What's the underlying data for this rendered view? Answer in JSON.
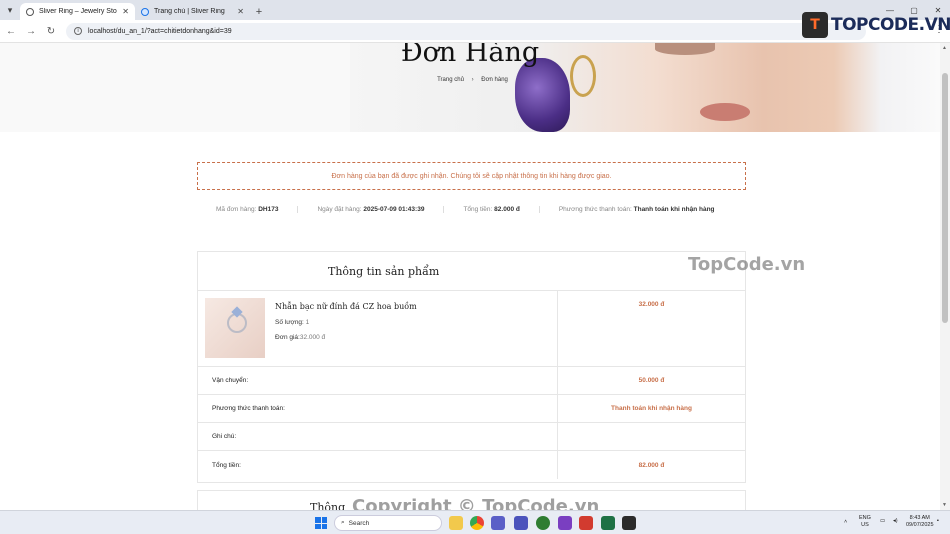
{
  "browser": {
    "tabs": [
      {
        "title": "Sliver Ring – Jewelry Store",
        "active": true
      },
      {
        "title": "Trang chủ | Sliver Ring",
        "active": false
      }
    ],
    "url": "localhost/du_an_1/?act=chitietdonhang&id=39",
    "new_tab": "+",
    "window_controls": [
      "—",
      "▢",
      "✕"
    ]
  },
  "logo": {
    "mark": "T",
    "text": "TOPCODE.VN"
  },
  "hero": {
    "title": "Đơn Hàng",
    "breadcrumb_home": "Trang chủ",
    "breadcrumb_sep": "›",
    "breadcrumb_current": "Đơn hàng"
  },
  "notice": "Đơn hàng của bạn đã được ghi nhận. Chúng tôi sẽ cập nhật thông tin khi hàng được giao.",
  "meta": {
    "order_code_label": "Mã đơn hàng:",
    "order_code": "DH173",
    "date_label": "Ngày đặt hàng:",
    "date": "2025-07-09 01:43:39",
    "total_label": "Tổng tiền:",
    "total": "82.000 đ",
    "payment_label": "Phương thức thanh toán:",
    "payment": "Thanh toán khi nhận hàng"
  },
  "product_card": {
    "heading": "Thông tin sản phẩm",
    "product": {
      "name": "Nhẫn bạc nữ đính đá CZ hoa buồm",
      "qty_label": "Số lượng:",
      "qty": "1",
      "price_label": "Đơn giá:",
      "price": "32.000 đ",
      "line_total": "32.000 đ"
    },
    "summary": [
      {
        "label": "Vận chuyển:",
        "value": "50.000 đ"
      },
      {
        "label": "Phương thức thanh toán:",
        "value": "Thanh toán khi nhận hàng"
      },
      {
        "label": "Ghi chú:",
        "value": ""
      },
      {
        "label": "Tổng tiền:",
        "value": "82.000 đ"
      }
    ]
  },
  "second_card_heading": "Thông",
  "watermarks": {
    "mid": "TopCode.vn",
    "bottom": "Copyright © TopCode.vn"
  },
  "taskbar": {
    "search_placeholder": "Search",
    "lang_top": "ENG",
    "lang_bottom": "US",
    "time": "8:43 AM",
    "date": "09/07/2025"
  }
}
